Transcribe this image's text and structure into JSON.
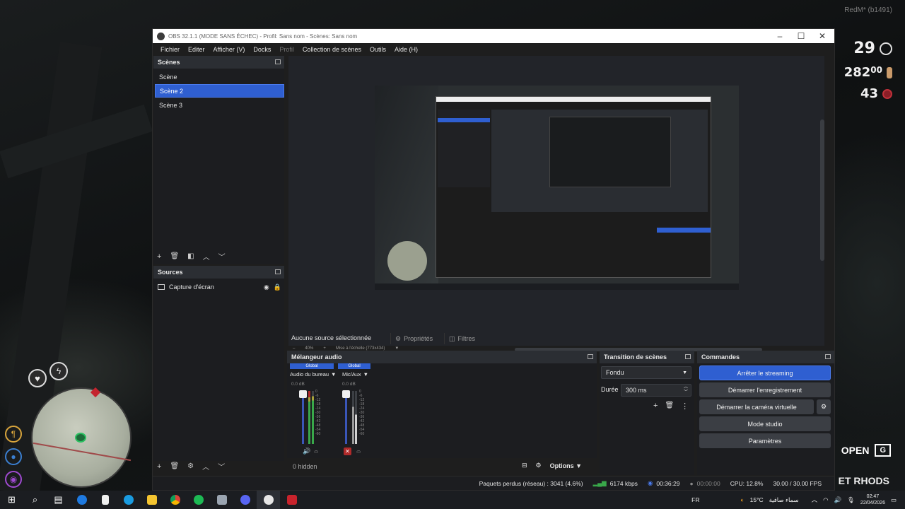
{
  "game": {
    "title_overlay": "RedM* (b1491)",
    "hud_top": "29",
    "hud_money": "282",
    "hud_money_cents": "00",
    "hud_count": "43",
    "open_label": "OPEN",
    "open_key": "G",
    "location": "ET RHODS"
  },
  "obs": {
    "window_title": "OBS 32.1.1 (MODE SANS ÉCHEC) - Profil: Sans nom - Scènes: Sans nom",
    "menu": [
      "Fichier",
      "Editer",
      "Afficher (V)",
      "Docks",
      "Profil",
      "Collection de scènes",
      "Outils",
      "Aide (H)"
    ],
    "scenes": {
      "title": "Scènes",
      "items": [
        "Scène",
        "Scène 2",
        "Scène 3"
      ],
      "selected": "Scène 2"
    },
    "sources": {
      "title": "Sources",
      "items": [
        "Capture d'écran"
      ],
      "hidden_label": "0 hidden"
    },
    "preview": {
      "zoom_label": "40%",
      "scale_label": "Mise à l'échelle (773x434)"
    },
    "no_source": "Aucune source sélectionnée",
    "properties_label": "Propriétés",
    "filters_label": "Filtres",
    "mixer": {
      "title": "Mélangeur audio",
      "tag_left": "Global",
      "tag_right": "Global",
      "channels": [
        {
          "name": "Audio du bureau",
          "db": "0.0 dB"
        },
        {
          "name": "Mic/Aux",
          "db": "0.0 dB"
        }
      ],
      "scale": [
        "0",
        "-6",
        "-12",
        "-18",
        "-24",
        "-30",
        "-36",
        "-42",
        "-48",
        "-54",
        "-60"
      ],
      "options_label": "Options"
    },
    "transitions": {
      "title": "Transition de scènes",
      "type": "Fondu",
      "duration_label": "Durée",
      "duration_value": "300 ms"
    },
    "controls": {
      "title": "Commandes",
      "buttons": [
        "Arrêter le streaming",
        "Démarrer l'enregistrement",
        "Démarrer la caméra virtuelle",
        "Mode studio",
        "Paramètres"
      ]
    },
    "status": {
      "dropped": "Paquets perdus (réseau) : 3041 (4.6%)",
      "bitrate": "6174 kbps",
      "stream_time": "00:36:29",
      "rec_time": "00:00:00",
      "cpu": "CPU: 12.8%",
      "fps": "30.00 / 30.00 FPS"
    }
  },
  "taskbar": {
    "lang": "FR",
    "temp": "15°C",
    "weather": "سماء صافية",
    "time": "02:47",
    "date": "22/04/2026"
  },
  "colors": {
    "accent": "#2f5fd1",
    "panel": "#1c1d20",
    "header": "#2b2e33"
  }
}
